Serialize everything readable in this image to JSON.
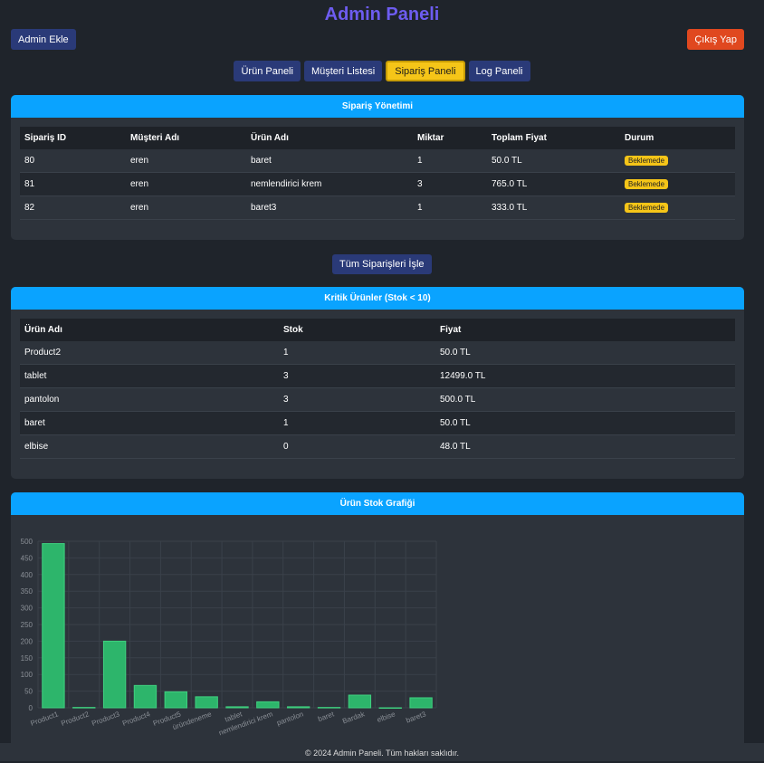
{
  "header": {
    "title": "Admin Paneli"
  },
  "toolbar": {
    "admin_add": "Admin Ekle",
    "logout": "Çıkış Yap"
  },
  "nav": [
    {
      "label": "Ürün Paneli",
      "active": false
    },
    {
      "label": "Müşteri Listesi",
      "active": false
    },
    {
      "label": "Sipariş Paneli",
      "active": true
    },
    {
      "label": "Log Paneli",
      "active": false
    }
  ],
  "orders": {
    "title": "Sipariş Yönetimi",
    "columns": [
      "Sipariş ID",
      "Müşteri Adı",
      "Ürün Adı",
      "Miktar",
      "Toplam Fiyat",
      "Durum"
    ],
    "rows": [
      {
        "id": "80",
        "customer": "eren",
        "product": "baret",
        "qty": "1",
        "total": "50.0 TL",
        "status": "Beklemede"
      },
      {
        "id": "81",
        "customer": "eren",
        "product": "nemlendirici krem",
        "qty": "3",
        "total": "765.0 TL",
        "status": "Beklemede"
      },
      {
        "id": "82",
        "customer": "eren",
        "product": "baret3",
        "qty": "1",
        "total": "333.0 TL",
        "status": "Beklemede"
      }
    ]
  },
  "process_all": "Tüm Siparişleri İşle",
  "critical": {
    "title": "Kritik Ürünler (Stok < 10)",
    "columns": [
      "Ürün Adı",
      "Stok",
      "Fiyat"
    ],
    "rows": [
      {
        "name": "Product2",
        "stock": "1",
        "price": "50.0 TL"
      },
      {
        "name": "tablet",
        "stock": "3",
        "price": "12499.0 TL"
      },
      {
        "name": "pantolon",
        "stock": "3",
        "price": "500.0 TL"
      },
      {
        "name": "baret",
        "stock": "1",
        "price": "50.0 TL"
      },
      {
        "name": "elbise",
        "stock": "0",
        "price": "48.0 TL"
      }
    ]
  },
  "chart_panel": {
    "title": "Ürün Stok Grafiği"
  },
  "chart_data": {
    "type": "bar",
    "categories": [
      "Product1",
      "Product2",
      "Product3",
      "Product4",
      "Product5",
      "üründeneme",
      "tablet",
      "nemlendirici krem",
      "pantolon",
      "baret",
      "Bardak",
      "elbise",
      "baret3"
    ],
    "values": [
      493,
      1,
      200,
      67,
      48,
      33,
      3,
      18,
      3,
      1,
      38,
      0,
      30
    ],
    "ylim": [
      0,
      500
    ],
    "yticks": [
      0,
      50,
      100,
      150,
      200,
      250,
      300,
      350,
      400,
      450,
      500
    ],
    "grid": true,
    "colors": {
      "bar": "#2db56b",
      "bar_border": "#3fd07f",
      "grid": "#3a414a",
      "tick": "#8a8f96"
    }
  },
  "footer": {
    "text": "© 2024 Admin Paneli. Tüm hakları saklıdır."
  }
}
